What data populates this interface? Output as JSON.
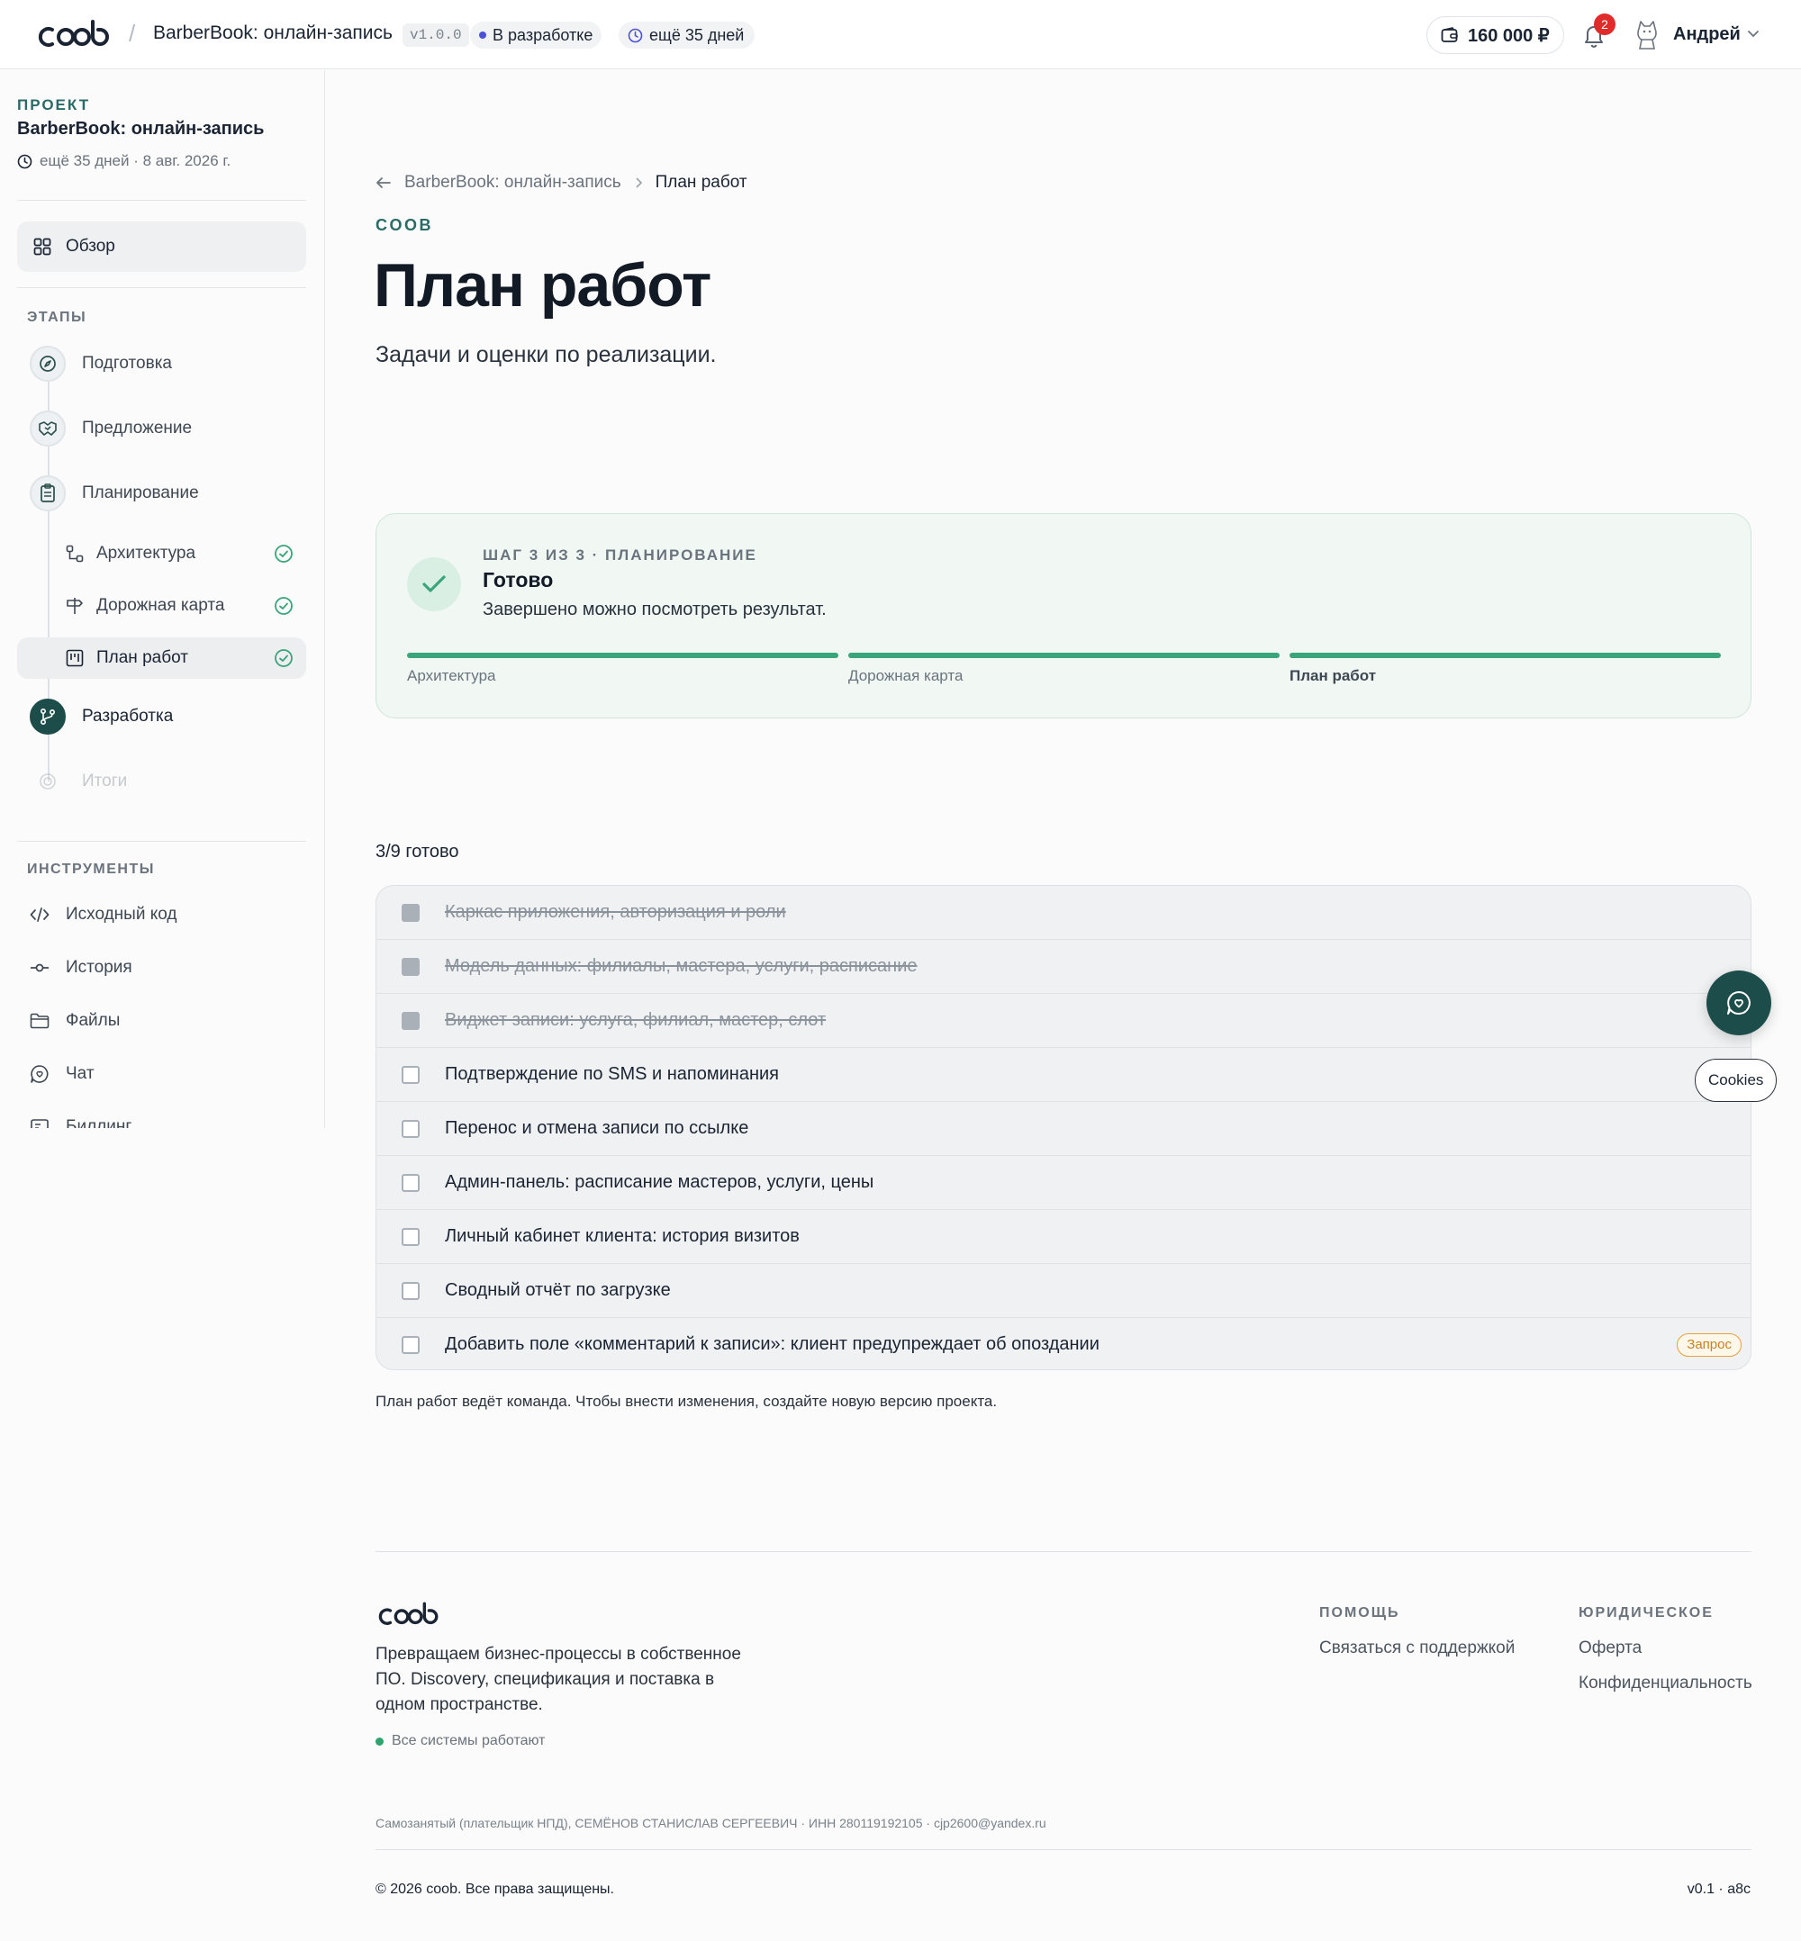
{
  "header": {
    "brand": "coob",
    "project_title": "BarberBook: онлайн-запись",
    "version": "v1.0.0",
    "status": "В разработке",
    "days_left": "ещё 35 дней",
    "balance": "160 000 ₽",
    "notifications_count": "2",
    "user_name": "Андрей"
  },
  "sidebar": {
    "project_label": "ПРОЕКТ",
    "project_name": "BarberBook: онлайн-запись",
    "deadline": "ещё 35 дней · 8 авг. 2026 г.",
    "overview": "Обзор",
    "stages_label": "ЭТАПЫ",
    "stages": [
      {
        "label": "Подготовка",
        "icon": "compass-icon"
      },
      {
        "label": "Предложение",
        "icon": "handshake-icon"
      },
      {
        "label": "Планирование",
        "icon": "clipboard-icon"
      },
      {
        "label": "Разработка",
        "icon": "git-branch-icon"
      },
      {
        "label": "Итоги",
        "icon": "target-icon"
      }
    ],
    "substages": [
      {
        "label": "Архитектура",
        "icon": "architecture-icon",
        "done": true
      },
      {
        "label": "Дорожная карта",
        "icon": "signpost-icon",
        "done": true
      },
      {
        "label": "План работ",
        "icon": "kanban-icon",
        "done": true
      }
    ],
    "tools_label": "ИНСТРУМЕНТЫ",
    "tools": [
      {
        "label": "Исходный код",
        "icon": "code-icon"
      },
      {
        "label": "История",
        "icon": "commit-icon"
      },
      {
        "label": "Файлы",
        "icon": "folder-icon"
      },
      {
        "label": "Чат",
        "icon": "chat-icon"
      },
      {
        "label": "Биллинг",
        "icon": "billing-icon"
      }
    ]
  },
  "main": {
    "breadcrumb": {
      "parent": "BarberBook: онлайн-запись",
      "current": "План работ"
    },
    "eyebrow": "COOB",
    "title": "План работ",
    "subtitle": "Задачи и оценки по реализации.",
    "step_card": {
      "eyebrow": "ШАГ 3 ИЗ 3 · ПЛАНИРОВАНИЕ",
      "title": "Готово",
      "description": "Завершено можно посмотреть результат.",
      "steps": [
        {
          "label": "Архитектура",
          "progress": 1
        },
        {
          "label": "Дорожная карта",
          "progress": 1
        },
        {
          "label": "План работ",
          "progress": 1
        }
      ]
    },
    "progress_text": "3/9 готово",
    "tasks": [
      {
        "label": "Каркас приложения, авторизация и роли",
        "done": true
      },
      {
        "label": "Модель данных: филиалы, мастера, услуги, расписание",
        "done": true
      },
      {
        "label": "Виджет записи: услуга, филиал, мастер, слот",
        "done": true
      },
      {
        "label": "Подтверждение по SMS и напоминания",
        "done": false
      },
      {
        "label": "Перенос и отмена записи по ссылке",
        "done": false
      },
      {
        "label": "Админ-панель: расписание мастеров, услуги, цены",
        "done": false
      },
      {
        "label": "Личный кабинет клиента: история визитов",
        "done": false
      },
      {
        "label": "Сводный отчёт по загрузке",
        "done": false
      },
      {
        "label": "Добавить поле «комментарий к записи»: клиент предупреждает об опоздании",
        "done": false,
        "badge": "Запрос"
      }
    ],
    "note": "План работ ведёт команда. Чтобы внести изменения, создайте новую версию проекта."
  },
  "floating": {
    "chat_icon": "chat-bubble-icon",
    "cookies": "Cookies"
  },
  "footer": {
    "brand": "coob",
    "tagline": "Превращаем бизнес-процессы в собственное ПО. Discovery, спецификация и поставка в одном пространстве.",
    "status": "Все системы работают",
    "help_title": "ПОМОЩЬ",
    "help_links": [
      "Связаться с поддержкой"
    ],
    "legal_title": "ЮРИДИЧЕСКОЕ",
    "legal_links": [
      "Оферта",
      "Конфиденциальность"
    ],
    "legal_text": "Самозанятый (плательщик НПД), СЕМЁНОВ СТАНИСЛАВ СЕРГЕЕВИЧ · ИНН 280119192105 · cjp2600@yandex.ru",
    "copyright": "© 2026 coob. Все права защищены.",
    "version": "v0.1 · a8c"
  },
  "colors": {
    "accent": "#1d4d4a",
    "success": "#3aa57a",
    "eyebrow": "#2a6b67",
    "request_badge": "#e6a13c"
  }
}
